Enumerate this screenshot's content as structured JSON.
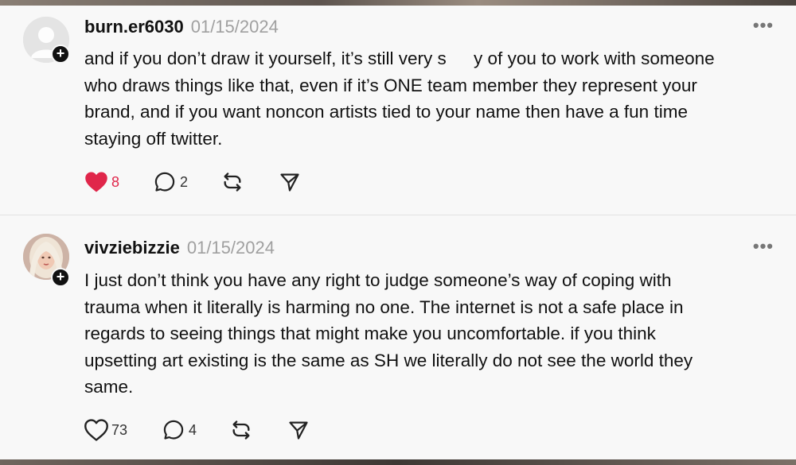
{
  "posts": [
    {
      "username": "burn.er6030",
      "date": "01/15/2024",
      "more_label": "•••",
      "lines": {
        "l1a": "and if you don’t draw it yourself, it’s still very s",
        "l1b": "y of you to work with someone",
        "l2": "who draws things like that, even if it’s ONE team member they represent your",
        "l3": "brand, and if you want noncon artists tied to your name then have a fun time",
        "l4": "staying off twitter."
      },
      "likes": "8",
      "liked": true,
      "replies": "2",
      "avatar_icon": "default-avatar-icon"
    },
    {
      "username": "vivziebizzie",
      "date": "01/15/2024",
      "more_label": "•••",
      "lines": {
        "l1": "I just don’t think you have any right to judge someone’s way of coping with",
        "l2": "trauma when it literally is harming no one. The internet is not a safe place in",
        "l3": "regards to seeing things that might make you uncomfortable. if you think",
        "l4": "upsetting art existing is the same as SH we literally do not see the world they",
        "l5": "same."
      },
      "likes": "73",
      "liked": false,
      "replies": "4",
      "avatar_icon": "profile-photo"
    }
  ],
  "colors": {
    "like_active": "#e0264a",
    "text": "#111111",
    "muted": "#a0a0a0"
  },
  "icons": [
    "heart-icon",
    "comment-icon",
    "repost-icon",
    "share-icon",
    "more-icon",
    "follow-plus-icon"
  ]
}
